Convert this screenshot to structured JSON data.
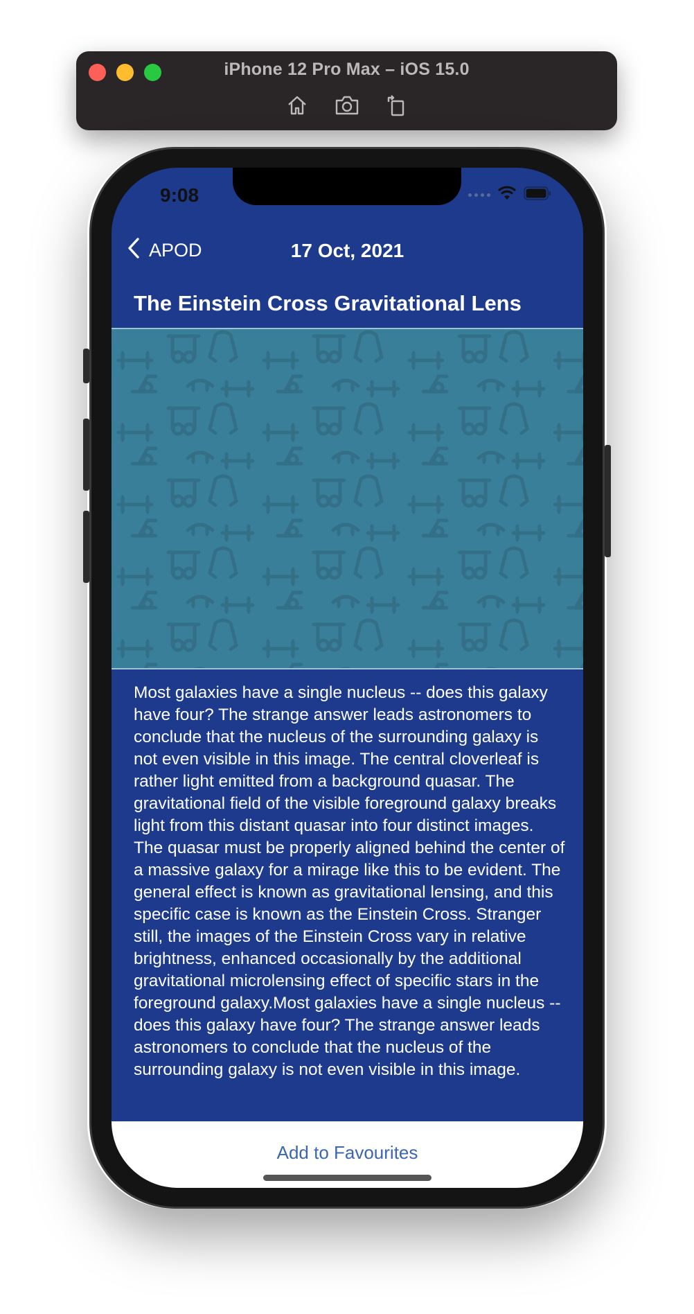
{
  "simulator": {
    "title": "iPhone 12 Pro Max – iOS 15.0",
    "tools": [
      "home-icon",
      "screenshot-icon",
      "rotate-icon"
    ]
  },
  "status_bar": {
    "time": "9:08"
  },
  "nav": {
    "back_label": "APOD",
    "title": "17 Oct, 2021"
  },
  "post": {
    "title": "The Einstein Cross Gravitational Lens",
    "explanation": "Most galaxies have a single nucleus -- does this galaxy have four?  The strange answer leads astronomers to conclude that the nucleus of the surrounding galaxy is not even visible in this image.  The central cloverleaf is rather light emitted from a background quasar.  The gravitational field of the visible foreground galaxy breaks light from this distant quasar into four distinct images.  The quasar must be properly aligned behind the center of a massive galaxy for a mirage like this to be evident.  The general effect is known as gravitational lensing, and this specific case is known as the Einstein Cross.  Stranger still, the images of the Einstein Cross vary in relative brightness, enhanced occasionally by the additional gravitational microlensing effect of specific stars in the foreground galaxy.Most galaxies have a single nucleus -- does this galaxy have four?  The strange answer leads astronomers to conclude that the nucleus of the surrounding galaxy is not even visible in this image."
  },
  "footer": {
    "favourite_label": "Add to Favourites"
  },
  "colors": {
    "nav_background": "#1d3a8c",
    "image_placeholder": "#3a7f99",
    "link": "#3b66b0"
  }
}
